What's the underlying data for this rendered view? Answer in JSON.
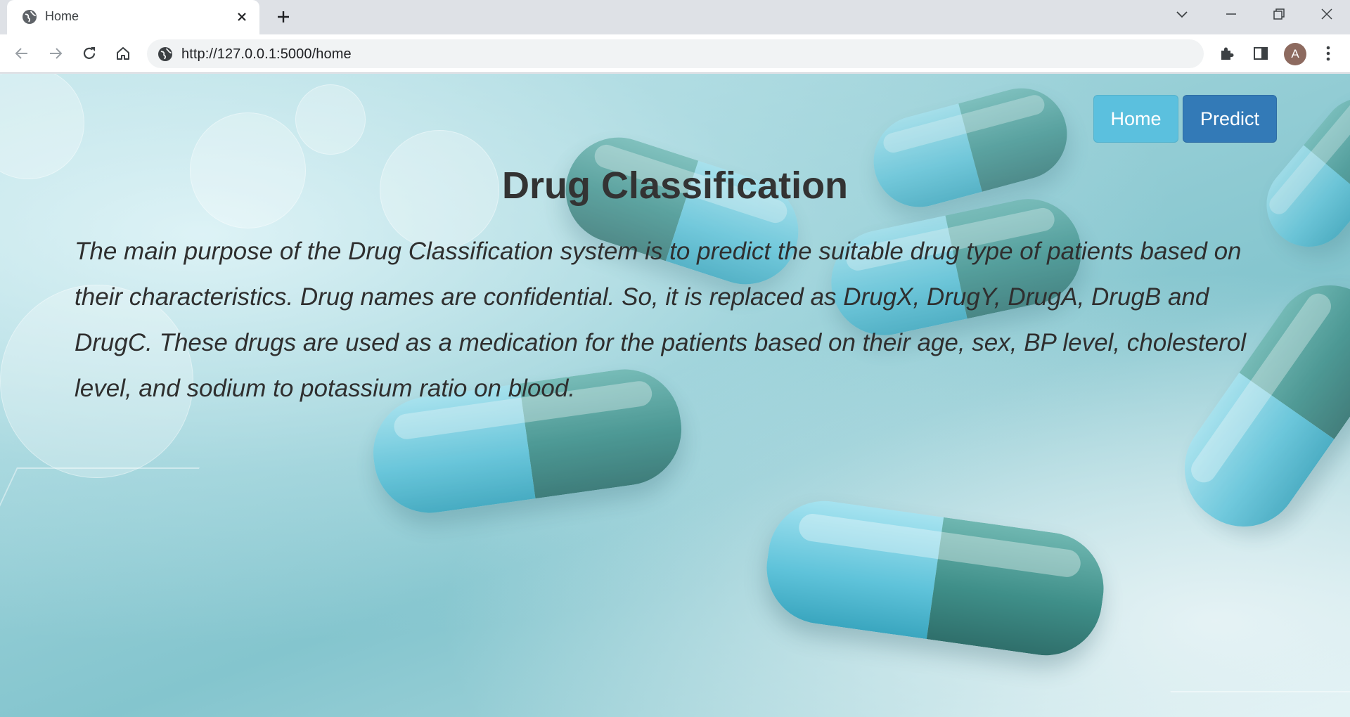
{
  "browser": {
    "tab_title": "Home",
    "url": "http://127.0.0.1:5000/home",
    "profile_initial": "A",
    "icons": {
      "favicon": "globe-icon",
      "tab_close": "close-icon",
      "new_tab": "plus-icon",
      "tab_search": "chevron-down-icon",
      "minimize": "minimize-icon",
      "restore": "restore-icon",
      "close_window": "close-icon",
      "back": "arrow-left-icon",
      "forward": "arrow-right-icon",
      "reload": "reload-icon",
      "home": "home-icon",
      "site_info": "globe-icon",
      "extensions": "puzzle-icon",
      "side_panel": "side-panel-icon",
      "menu": "more-vertical-icon"
    }
  },
  "page": {
    "nav": {
      "home_label": "Home",
      "predict_label": "Predict",
      "home_color": "#5bc0de",
      "predict_color": "#337ab7"
    },
    "title": "Drug Classification",
    "description": "The main purpose of the Drug Classification system is to predict the suitable drug type of patients based on their characteristics. Drug names are confidential. So, it is replaced as DrugX, DrugY, DrugA, DrugB and DrugC. These drugs are used as a medication for the patients based on their age, sex, BP level, cholesterol level, and sodium to potassium ratio on blood."
  }
}
